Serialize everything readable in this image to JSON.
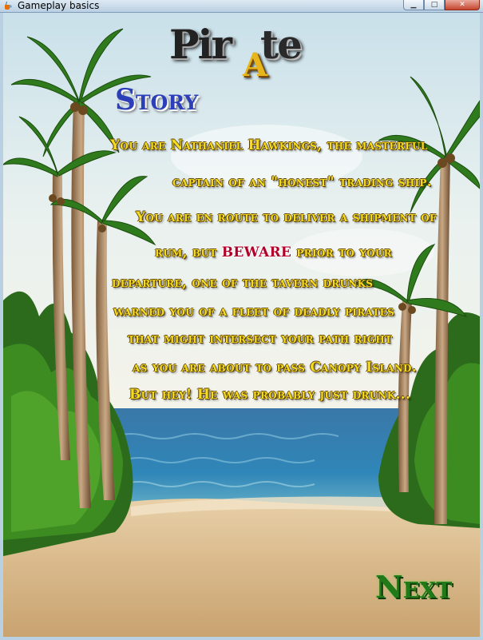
{
  "window": {
    "title": "Gameplay basics",
    "app_icon": "java-cup-icon",
    "minimize": "▁",
    "maximize": "□",
    "close": "✕"
  },
  "logo": {
    "part1": "Pir",
    "part2": "A",
    "part3": "te"
  },
  "heading": "Story",
  "story": {
    "line1": "You are Nathaniel Hawkings, the masterful",
    "line2": "captain of an \"honest\" trading ship.",
    "line3": "You are en route to deliver a shipment of",
    "line4_before": "rum, but",
    "line4_highlight": "BEWARE",
    "line4_after": "prior to your",
    "line5": "departure, one of the tavern drunks",
    "line6": "warned you of a fleet of deadly pirates",
    "line7": "that might intersect your path right",
    "line8": "as you are about to pass Canopy Island.",
    "line9": "But hey! He was probably just drunk..."
  },
  "next_label": "Next",
  "colors": {
    "story_text": "#f4dc1e",
    "beware": "#b3002a",
    "heading": "#2c3fb8",
    "next": "#1f7a17",
    "sand": "#e2c8a0",
    "sea": "#2e7bb0"
  }
}
